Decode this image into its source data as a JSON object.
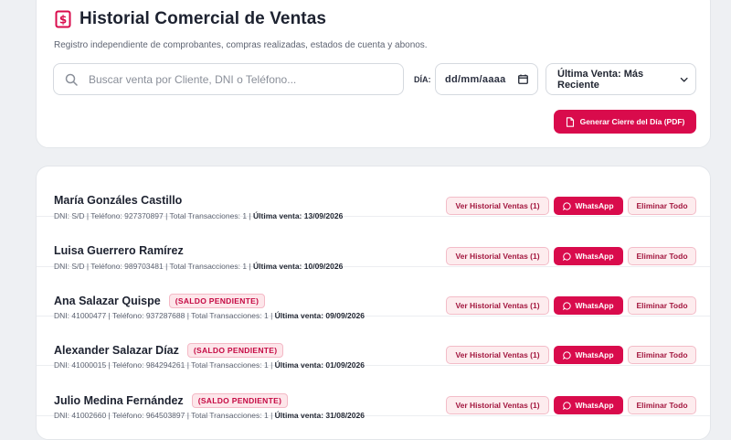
{
  "header": {
    "title": "Historial Comercial de Ventas",
    "subtitle": "Registro independiente de comprobantes, compras realizadas, estados de cuenta y abonos.",
    "icon": "receipt-dollar-icon"
  },
  "filters": {
    "search_placeholder": "Buscar venta por Cliente, DNI o Teléfono...",
    "search_value": "",
    "dia_label": "DÍA:",
    "date_value": "dd/mm/aaaa",
    "sort_selected": "Última Venta: Más Reciente"
  },
  "actions": {
    "pdf_label": "Generar Cierre del Día (PDF)"
  },
  "labels": {
    "history": "Ver Historial Ventas (1)",
    "whatsapp": "WhatsApp",
    "delete": "Eliminar Todo",
    "badge": "(SALDO PENDIENTE)",
    "last_sale": "Última venta:"
  },
  "colors": {
    "accent": "#d90b4c",
    "badge_bg": "#fde6ea"
  },
  "clients": [
    {
      "name": "María Gonzáles Castillo",
      "pending": false,
      "meta": "DNI: S/D | Teléfono: 927370897 | Total Transacciones: 1 |",
      "last": "13/09/2026"
    },
    {
      "name": "Luisa Guerrero Ramírez",
      "pending": false,
      "meta": "DNI: S/D | Teléfono: 989703481 | Total Transacciones: 1 |",
      "last": "10/09/2026"
    },
    {
      "name": "Ana Salazar Quispe",
      "pending": true,
      "meta": "DNI: 41000477 | Teléfono: 937287688 | Total Transacciones: 1 |",
      "last": "09/09/2026"
    },
    {
      "name": "Alexander Salazar Díaz",
      "pending": true,
      "meta": "DNI: 41000015 | Teléfono: 984294261 | Total Transacciones: 1 |",
      "last": "01/09/2026"
    },
    {
      "name": "Julio Medina Fernández",
      "pending": true,
      "meta": "DNI: 41002660 | Teléfono: 964503897 | Total Transacciones: 1 |",
      "last": "31/08/2026"
    }
  ]
}
